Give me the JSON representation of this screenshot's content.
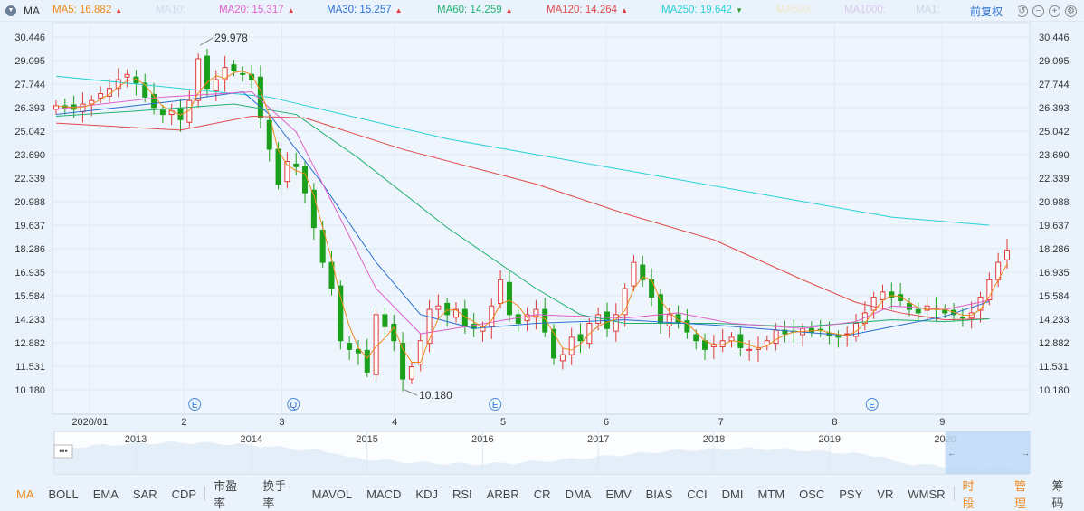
{
  "header": {
    "indicator": "MA",
    "ma": [
      {
        "label": "MA5: 16.882",
        "color": "#f08a1c",
        "trend": "up"
      },
      {
        "label": "MA10:",
        "color": "#c9dcf0",
        "trend": ""
      },
      {
        "label": "MA20: 15.317",
        "color": "#e060c8",
        "trend": "up"
      },
      {
        "label": "MA30: 15.257",
        "color": "#2a6fd0",
        "trend": "up"
      },
      {
        "label": "MA60: 14.259",
        "color": "#22b070",
        "trend": "up"
      },
      {
        "label": "MA120: 14.264",
        "color": "#e04a4a",
        "trend": "up"
      },
      {
        "label": "MA250: 19.642",
        "color": "#2ad0d8",
        "trend": "down"
      },
      {
        "label": "MA500:",
        "color": "#f0e6c8",
        "trend": ""
      },
      {
        "label": "MA1000:",
        "color": "#d8c8ee",
        "trend": ""
      },
      {
        "label": "MA1:",
        "color": "#c8d6e4",
        "trend": ""
      }
    ],
    "adjust_label": "前复权",
    "up_glyph": "▲",
    "down_glyph": "▼"
  },
  "chart_data": {
    "type": "candlestick",
    "ylim": [
      10.18,
      30.446
    ],
    "yticks": [
      "30.446",
      "29.095",
      "27.744",
      "26.393",
      "25.042",
      "23.690",
      "22.339",
      "20.988",
      "19.637",
      "18.286",
      "16.935",
      "15.584",
      "14.233",
      "12.882",
      "11.531",
      "10.180"
    ],
    "closes": [
      26.5,
      26.4,
      26.3,
      26.6,
      26.8,
      27.2,
      27.5,
      28.0,
      28.3,
      27.8,
      27.0,
      26.4,
      26.0,
      26.2,
      25.7,
      26.8,
      29.2,
      27.5,
      28.0,
      28.7,
      28.5,
      28.3,
      28.0,
      25.8,
      24.0,
      22.0,
      23.3,
      23.0,
      21.5,
      19.5,
      17.5,
      16.0,
      13.0,
      12.5,
      12.3,
      11.2,
      14.5,
      13.8,
      13.0,
      10.8,
      11.5,
      13.0,
      14.8,
      15.0,
      14.5,
      14.8,
      13.8,
      13.7,
      13.8,
      15.0,
      16.5,
      14.5,
      14.0,
      14.5,
      14.8,
      13.5,
      12.0,
      12.2,
      13.2,
      13.0,
      14.0,
      14.5,
      13.7,
      14.5,
      16.0,
      17.5,
      16.5,
      15.5,
      14.0,
      14.5,
      14.0,
      13.5,
      13.0,
      12.5,
      12.8,
      13.0,
      13.2,
      12.6,
      12.5,
      12.6,
      13.0,
      13.6,
      13.4,
      13.5,
      13.7,
      13.5,
      13.6,
      13.3,
      13.2,
      13.4,
      14.0,
      14.6,
      15.5,
      15.8,
      15.5,
      15.3,
      14.8,
      14.6,
      15.0,
      14.8,
      14.6,
      14.5,
      14.3,
      14.6,
      15.5,
      16.5,
      17.5,
      18.2
    ],
    "series": [
      {
        "name": "MA250",
        "color": "#2ad0d8",
        "points": [
          [
            0,
            28.2
          ],
          [
            24,
            27.0
          ],
          [
            44,
            24.6
          ],
          [
            64,
            22.8
          ],
          [
            84,
            21.0
          ],
          [
            94,
            20.1
          ],
          [
            105,
            19.64
          ]
        ]
      },
      {
        "name": "MA120",
        "color": "#e04a4a",
        "points": [
          [
            0,
            25.5
          ],
          [
            14,
            25.1
          ],
          [
            22,
            25.9
          ],
          [
            28,
            25.8
          ],
          [
            39,
            24.0
          ],
          [
            54,
            22.0
          ],
          [
            64,
            20.3
          ],
          [
            74,
            18.8
          ],
          [
            84,
            16.5
          ],
          [
            90,
            15.2
          ],
          [
            95,
            14.6
          ],
          [
            100,
            14.2
          ],
          [
            105,
            14.26
          ]
        ]
      },
      {
        "name": "MA60",
        "color": "#22b070",
        "points": [
          [
            0,
            25.9
          ],
          [
            9,
            26.2
          ],
          [
            20,
            26.6
          ],
          [
            27,
            26.0
          ],
          [
            34,
            23.5
          ],
          [
            44,
            19.5
          ],
          [
            54,
            16.0
          ],
          [
            59,
            14.5
          ],
          [
            64,
            14.0
          ],
          [
            74,
            14.0
          ],
          [
            84,
            13.8
          ],
          [
            94,
            14.2
          ],
          [
            100,
            14.1
          ],
          [
            105,
            14.26
          ]
        ]
      },
      {
        "name": "MA30",
        "color": "#2a6fd0",
        "points": [
          [
            0,
            26.0
          ],
          [
            14,
            26.8
          ],
          [
            21,
            27.3
          ],
          [
            24,
            26.0
          ],
          [
            30,
            22.0
          ],
          [
            36,
            17.5
          ],
          [
            41,
            14.5
          ],
          [
            47,
            13.7
          ],
          [
            54,
            14.0
          ],
          [
            64,
            14.2
          ],
          [
            74,
            13.9
          ],
          [
            84,
            13.5
          ],
          [
            89,
            13.3
          ],
          [
            94,
            13.8
          ],
          [
            100,
            14.4
          ],
          [
            105,
            15.26
          ]
        ]
      },
      {
        "name": "MA20",
        "color": "#e060c8",
        "points": [
          [
            0,
            26.3
          ],
          [
            12,
            27.0
          ],
          [
            22,
            27.3
          ],
          [
            27,
            25.0
          ],
          [
            32,
            20.0
          ],
          [
            36,
            16.0
          ],
          [
            41,
            13.4
          ],
          [
            46,
            13.8
          ],
          [
            54,
            14.5
          ],
          [
            64,
            14.3
          ],
          [
            70,
            14.6
          ],
          [
            76,
            14.0
          ],
          [
            84,
            13.7
          ],
          [
            90,
            14.1
          ],
          [
            94,
            15.0
          ],
          [
            100,
            14.8
          ],
          [
            105,
            15.32
          ]
        ]
      }
    ],
    "ma5_color": "#f08a1c",
    "up_color": "#e03a3a",
    "down_color": "#1aa01a",
    "annotations": [
      {
        "text": "29.978",
        "index": 16,
        "value": 29.978
      },
      {
        "text": "10.180",
        "index": 39,
        "value": 10.18
      }
    ],
    "events": [
      {
        "text": "E",
        "index": 15.6
      },
      {
        "text": "Q",
        "index": 26.7
      },
      {
        "text": "E",
        "index": 49.4
      },
      {
        "text": "E",
        "index": 91.8
      }
    ],
    "xticks": [
      {
        "label": "2020/01",
        "index": 3.8
      },
      {
        "label": "2",
        "index": 14.4
      },
      {
        "label": "3",
        "index": 25.4
      },
      {
        "label": "4",
        "index": 38.1
      },
      {
        "label": "5",
        "index": 50.3
      },
      {
        "label": "6",
        "index": 61.9
      },
      {
        "label": "7",
        "index": 74.8
      },
      {
        "label": "8",
        "index": 87.6
      },
      {
        "label": "9",
        "index": 99.7
      }
    ]
  },
  "navigator": {
    "years": [
      "2013",
      "2014",
      "2015",
      "2016",
      "2017",
      "2018",
      "2019",
      "2020"
    ],
    "handle_label": "•••",
    "left_arrow": "←",
    "right_arrow": "→",
    "selected_fraction": [
      0.914,
      1.0
    ]
  },
  "tabs": [
    "MA",
    "BOLL",
    "EMA",
    "SAR",
    "CDP",
    "|",
    "市盈率",
    "换手率",
    "MAVOL",
    "MACD",
    "KDJ",
    "RSI",
    "ARBR",
    "CR",
    "DMA",
    "EMV",
    "BIAS",
    "CCI",
    "DMI",
    "MTM",
    "OSC",
    "PSY",
    "VR",
    "WMSR",
    "|",
    "时段"
  ],
  "right_tabs": [
    "管理",
    "筹码"
  ]
}
